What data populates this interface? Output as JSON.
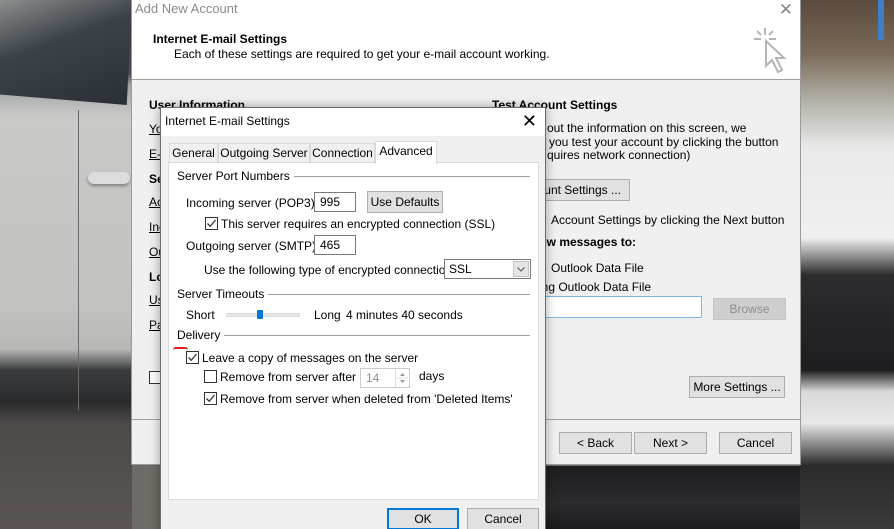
{
  "wizard": {
    "title": "Add New Account",
    "heading": "Internet E-mail Settings",
    "subheading": "Each of these settings are required to get your e-mail account working.",
    "left": {
      "user_info_title": "User Information",
      "your_name_label": "Yo",
      "email_label": "E-",
      "server_info_title": "Se",
      "account_type_label": "Ac",
      "incoming_label": "Inc",
      "outgoing_label": "Ou",
      "logon_title": "Lo",
      "username_label": "Us",
      "password_label": "Pa"
    },
    "right": {
      "test_title": "Test Account Settings",
      "test_text_1": "out the information on this screen, we",
      "test_text_2": "you test your account by clicking the button",
      "test_text_3": "quires network connection)",
      "test_button": "unt Settings ...",
      "auto_test_label": "Account Settings by clicking the Next button",
      "deliver_title": "ew messages to:",
      "new_data_file": "Outlook Data File",
      "existing_data_file": "ing Outlook Data File",
      "browse_button": "Browse",
      "more_settings_button": "More Settings ..."
    },
    "footer": {
      "back_button": "< Back",
      "next_button": "Next >",
      "cancel_button": "Cancel"
    }
  },
  "dialog": {
    "title": "Internet E-mail Settings",
    "tabs": [
      {
        "label": "General",
        "active": false
      },
      {
        "label": "Outgoing Server",
        "active": false
      },
      {
        "label": "Connection",
        "active": false
      },
      {
        "label": "Advanced",
        "active": true
      }
    ],
    "ports": {
      "group_label": "Server Port Numbers",
      "incoming_label": "Incoming server (POP3):",
      "incoming_value": "995",
      "use_defaults_button": "Use Defaults",
      "ssl_checkbox_label": "This server requires an encrypted connection (SSL)",
      "ssl_checked": true,
      "outgoing_label": "Outgoing server (SMTP):",
      "outgoing_value": "465",
      "encryption_label": "Use the following type of encrypted connection:",
      "encryption_value": "SSL"
    },
    "timeouts": {
      "group_label": "Server Timeouts",
      "short_label": "Short",
      "long_label": "Long",
      "value_text": "4 minutes 40 seconds",
      "slider_fraction": 0.46
    },
    "delivery": {
      "group_label": "Delivery",
      "leave_copy_label": "Leave a copy of messages on the server",
      "leave_copy_checked": true,
      "remove_after_label": "Remove from server after",
      "remove_after_checked": false,
      "remove_after_days": "14",
      "days_label": "days",
      "remove_deleted_label": "Remove from server when deleted from 'Deleted Items'",
      "remove_deleted_checked": true
    },
    "ok_button": "OK",
    "cancel_button": "Cancel"
  }
}
